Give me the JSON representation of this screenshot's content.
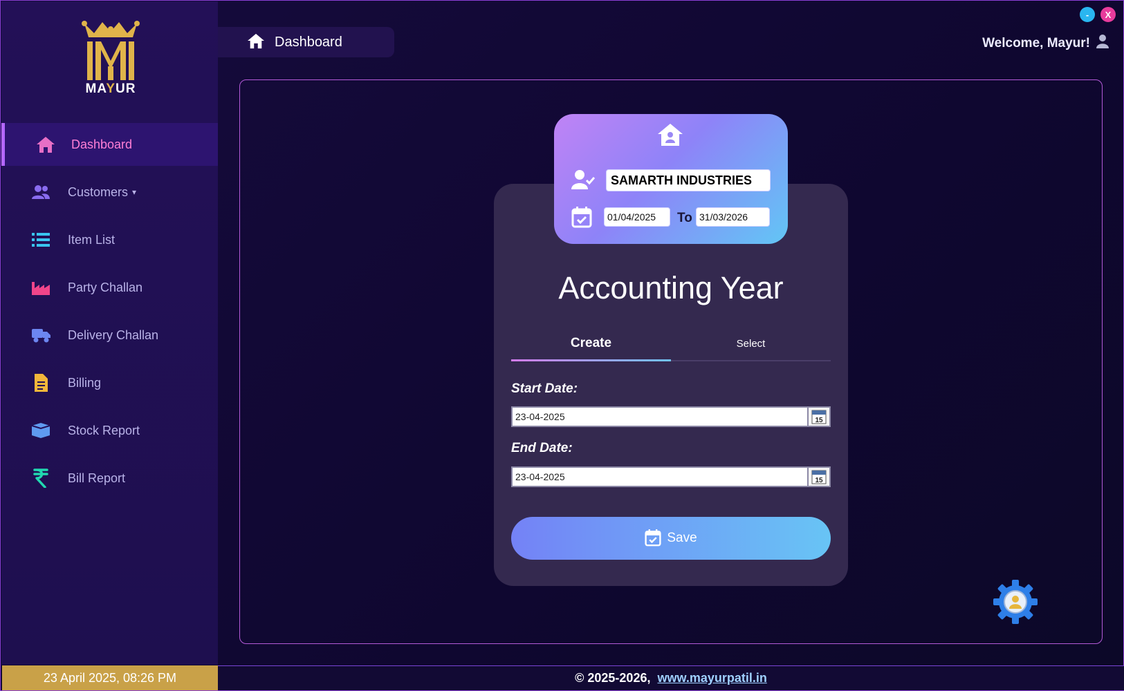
{
  "window": {
    "minimize_label": "-",
    "close_label": "X"
  },
  "brand": {
    "logo_text_a": "MA",
    "logo_text_y": "Y",
    "logo_text_b": "UR"
  },
  "sidebar": {
    "items": [
      {
        "label": "Dashboard",
        "icon": "home-icon",
        "color": "#e86fc6",
        "active": true
      },
      {
        "label": "Customers",
        "icon": "users-icon",
        "color": "#8a6cf0",
        "caret": "▾"
      },
      {
        "label": "Item List",
        "icon": "list-icon",
        "color": "#39c4f0"
      },
      {
        "label": "Party Challan",
        "icon": "factory-icon",
        "color": "#f0458a"
      },
      {
        "label": "Delivery Challan",
        "icon": "truck-icon",
        "color": "#6c86f0"
      },
      {
        "label": "Billing",
        "icon": "document-icon",
        "color": "#f2b63a"
      },
      {
        "label": "Stock Report",
        "icon": "box-icon",
        "color": "#5f9bf0"
      },
      {
        "label": "Bill Report",
        "icon": "rupee-icon",
        "color": "#21d8b0"
      }
    ]
  },
  "header": {
    "breadcrumb": "Dashboard",
    "welcome": "Welcome, Mayur!"
  },
  "company_card": {
    "company_name": "SAMARTH INDUSTRIES",
    "from_date": "01/04/2025",
    "to_label": "To",
    "to_date": "31/03/2026"
  },
  "form": {
    "title": "Accounting Year",
    "tabs": [
      {
        "label": "Create",
        "active": true
      },
      {
        "label": "Select",
        "active": false
      }
    ],
    "start_label": "Start Date:",
    "start_value": "23-04-2025",
    "end_label": "End Date:",
    "end_value": "23-04-2025",
    "calendar_day": "15",
    "save_label": "Save"
  },
  "footer": {
    "datetime": "23 April 2025, 08:26 PM",
    "copyright": "© 2025-2026,",
    "link": "www.mayurpatil.in"
  },
  "colors": {
    "accent_pink": "#b467ff",
    "gold": "#c9a148",
    "gradient_start": "#7482f6",
    "gradient_end": "#68c4f5"
  }
}
